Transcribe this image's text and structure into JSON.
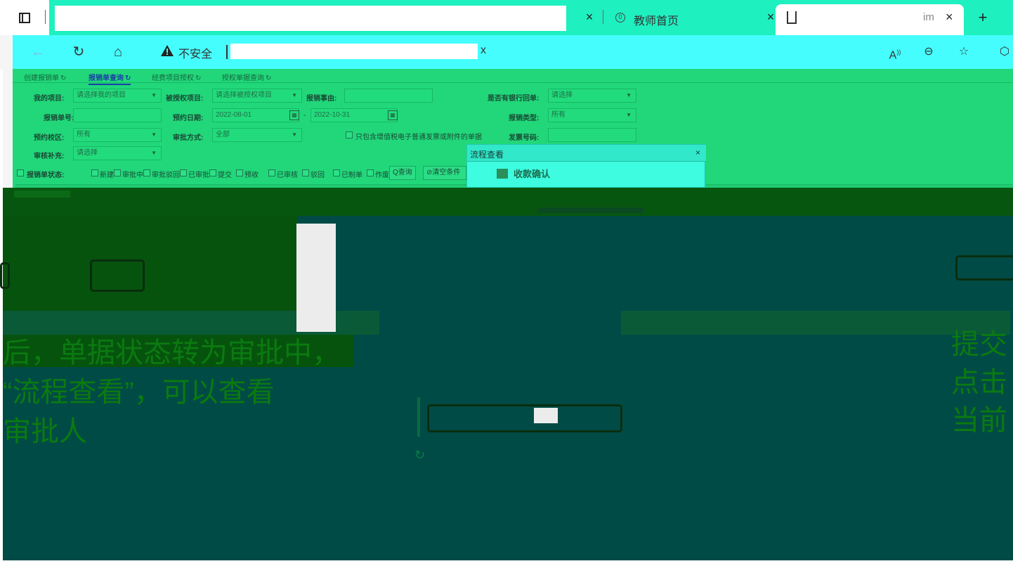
{
  "browser": {
    "tab_title": "教师首页",
    "tab_close": "×",
    "tab_partial_text": "im",
    "new_tab": "+",
    "security_label": "不安全",
    "url_tail": "x",
    "accent_color": "#1ef0c0"
  },
  "app": {
    "tabs": [
      {
        "label": "创建报销单",
        "icon": "↻"
      },
      {
        "label": "报销单查询",
        "icon": "↻"
      },
      {
        "label": "经费项目授权",
        "icon": "↻"
      },
      {
        "label": "授权单据查询",
        "icon": "↻"
      }
    ],
    "form": {
      "my_project_label": "我的项目:",
      "my_project_placeholder": "请选择我的项目",
      "auth_project_label": "被授权项目:",
      "auth_project_placeholder": "请选择被授权项目",
      "reason_label": "报销事由:",
      "bank_receipt_label": "是否有银行回单:",
      "bank_receipt_value": "请选择",
      "bill_no_label": "报销单号:",
      "booking_date_label": "预约日期:",
      "date_from": "2022-08-01",
      "date_sep": "-",
      "date_to": "2022-10-31",
      "bill_type_label": "报销类型:",
      "bill_type_value": "所有",
      "campus_label": "预约校区:",
      "campus_value": "所有",
      "approval_mode_label": "审批方式:",
      "approval_mode_value": "全部",
      "vat_only_label": "只包含增值税电子普通发票或附件的单据",
      "invoice_no_label": "发票号码:",
      "audit_supplement_label": "审核补充:",
      "audit_supplement_value": "请选择",
      "status_label": "报销单状态:",
      "statuses": [
        "新建",
        "审批中",
        "审批驳回",
        "已审批",
        "提交",
        "预收",
        "已审核",
        "驳回",
        "已制单",
        "作废"
      ],
      "search_button": "Q查询",
      "clear_button": "⊘清空条件"
    }
  },
  "popup": {
    "title": "流程查看",
    "close": "×",
    "step_label": "收款确认"
  },
  "slide": {
    "caption_lines": [
      "后，单据状态转为审批中，",
      "“流程查看”，可以查看",
      "审批人"
    ],
    "caption_right_lines": [
      "提交",
      "点击",
      "当前"
    ]
  }
}
